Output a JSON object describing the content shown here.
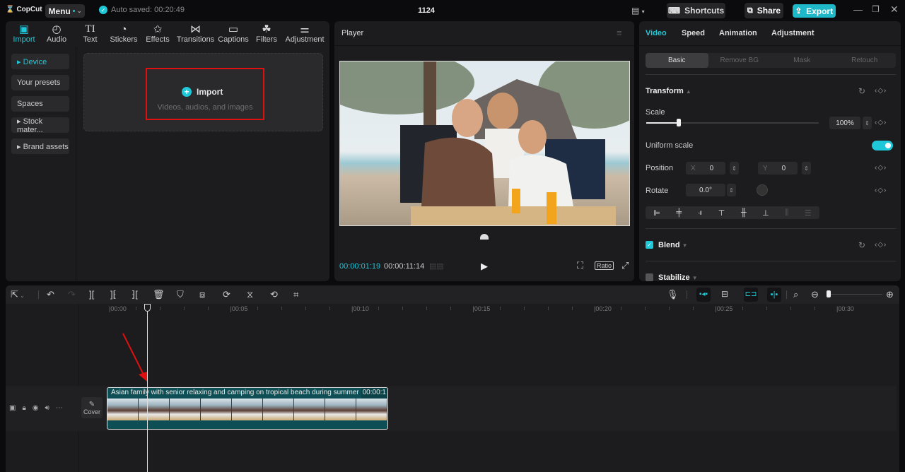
{
  "app": {
    "name": "CopCut",
    "menu_label": "Menu",
    "autosave_text": "Auto saved: 00:20:49",
    "project_title": "1124"
  },
  "topbar": {
    "shortcuts_label": "Shortcuts",
    "share_label": "Share",
    "export_label": "Export"
  },
  "tools_tabs": [
    {
      "label": "Import",
      "icon": "import-icon",
      "glyph": "▣",
      "active": true
    },
    {
      "label": "Audio",
      "icon": "audio-icon",
      "glyph": "◴"
    },
    {
      "label": "Text",
      "icon": "text-icon",
      "glyph": "TI"
    },
    {
      "label": "Stickers",
      "icon": "stickers-icon",
      "glyph": "◔"
    },
    {
      "label": "Effects",
      "icon": "effects-icon",
      "glyph": "✩"
    },
    {
      "label": "Transitions",
      "icon": "transitions-icon",
      "glyph": "⋈"
    },
    {
      "label": "Captions",
      "icon": "captions-icon",
      "glyph": "▭"
    },
    {
      "label": "Filters",
      "icon": "filters-icon",
      "glyph": "☘"
    },
    {
      "label": "Adjustment",
      "icon": "adjustment-icon",
      "glyph": "⚌"
    }
  ],
  "sidebar": {
    "items": [
      {
        "label": "▸ Device",
        "active": true
      },
      {
        "label": "Your presets"
      },
      {
        "label": "Spaces"
      },
      {
        "label": "▸ Stock mater..."
      },
      {
        "label": "▸ Brand assets"
      }
    ]
  },
  "import_box": {
    "title": "Import",
    "subtitle": "Videos, audios, and images"
  },
  "player": {
    "title": "Player",
    "current_time": "00:00:01:19",
    "total_time": "00:00:11:14",
    "ratio_label": "Ratio"
  },
  "properties": {
    "tabs": [
      "Video",
      "Speed",
      "Animation",
      "Adjustment"
    ],
    "active_tab": "Video",
    "subtabs": [
      "Basic",
      "Remove BG",
      "Mask",
      "Retouch"
    ],
    "active_subtab": "Basic",
    "transform_label": "Transform",
    "scale_label": "Scale",
    "scale_value": "100%",
    "scale_fraction": 0.19,
    "uniform_scale_label": "Uniform scale",
    "uniform_scale_on": true,
    "position_label": "Position",
    "x_label": "X",
    "x_value": "0",
    "y_label": "Y",
    "y_value": "0",
    "rotate_label": "Rotate",
    "rotate_value": "0.0°",
    "blend_label": "Blend",
    "blend_checked": true,
    "stabilize_label": "Stabilize",
    "stabilize_checked": false
  },
  "timeline": {
    "ruler": [
      "00:00",
      "00:05",
      "00:10",
      "00:15",
      "00:20",
      "00:25",
      "00:30"
    ],
    "clip_title": "Asian family with senior relaxing and camping on tropical beach during summer",
    "clip_duration": "00:00:1",
    "cover_label": "Cover"
  },
  "colors": {
    "accent": "#1fc8d8",
    "clip": "#0e4f55",
    "highlight": "#e01010"
  }
}
